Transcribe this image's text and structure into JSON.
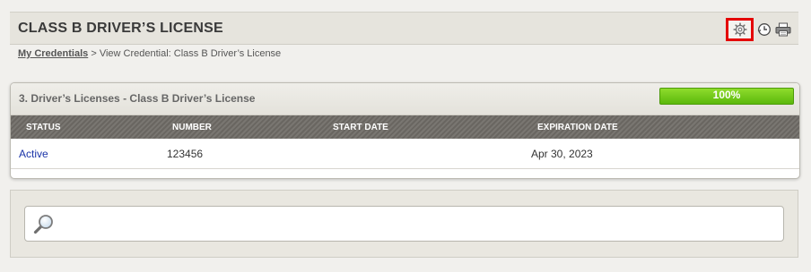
{
  "header": {
    "title": "CLASS B DRIVER’S LICENSE",
    "icons": [
      "gear-icon",
      "history-icon",
      "print-icon"
    ]
  },
  "breadcrumb": {
    "link": "My Credentials",
    "separator": ">",
    "current": "View Credential: Class B Driver’s License"
  },
  "credential_panel": {
    "title": "3. Driver’s Licenses - Class B Driver’s License",
    "progress_label": "100%",
    "progress_value": 100,
    "columns": [
      "STATUS",
      "NUMBER",
      "START DATE",
      "EXPIRATION DATE"
    ],
    "row": {
      "status": "Active",
      "number": "123456",
      "start_date": "",
      "expiration_date": "Apr 30, 2023"
    }
  },
  "search": {
    "value": "",
    "placeholder": ""
  },
  "colors": {
    "highlight_border": "#e40000",
    "progress_green": "#6cc814",
    "link_blue": "#1a33a8",
    "table_header": "#6f6c66"
  }
}
